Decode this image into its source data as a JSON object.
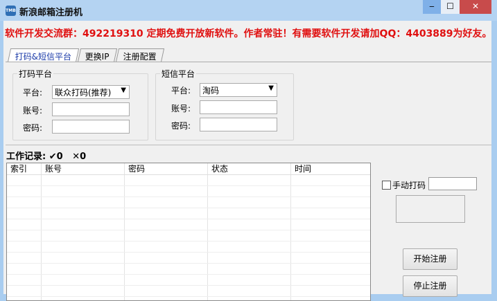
{
  "window": {
    "title": "新浪邮箱注册机",
    "icon_text": "TMB",
    "minimize": "‒",
    "maximize": "☐",
    "close": "✕"
  },
  "banner": "软件开发交流群：492219310  定期免费开放新软件。作者常驻！有需要软件开发请加QQ：4403889为好友。",
  "tabs": [
    {
      "label": "打码&短信平台"
    },
    {
      "label": "更换IP"
    },
    {
      "label": "注册配置"
    }
  ],
  "captcha_group": {
    "title": "打码平台",
    "platform_label": "平台:",
    "platform_value": "联众打码(推荐)",
    "account_label": "账号:",
    "account_value": "",
    "password_label": "密码:",
    "password_value": ""
  },
  "sms_group": {
    "title": "短信平台",
    "platform_label": "平台:",
    "platform_value": "淘码",
    "account_label": "账号:",
    "account_value": "",
    "password_label": "密码:",
    "password_value": ""
  },
  "worklog": {
    "label": "工作记录:",
    "success": "✔0",
    "fail": "✕0"
  },
  "table": {
    "columns": [
      "索引",
      "账号",
      "密码",
      "状态",
      "时间"
    ],
    "rows": []
  },
  "right": {
    "manual_captcha_label": "手动打码",
    "manual_captcha_value": "",
    "start_button": "开始注册",
    "stop_button": "停止注册"
  }
}
